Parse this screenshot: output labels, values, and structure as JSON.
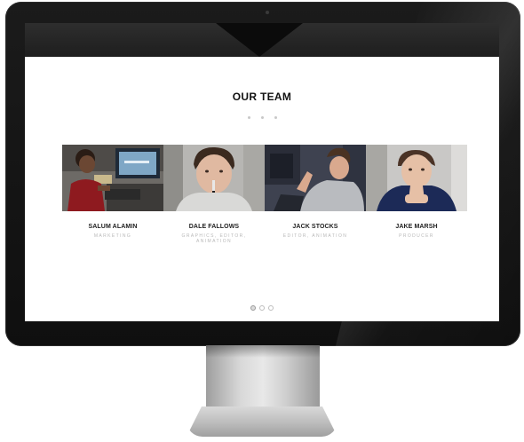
{
  "section": {
    "title": "OUR TEAM"
  },
  "team": [
    {
      "name": "SALUM ALAMIN",
      "role": "MARKETING"
    },
    {
      "name": "DALE FALLOWS",
      "role": "GRAPHICS, EDITOR, ANIMATION"
    },
    {
      "name": "JACK STOCKS",
      "role": "EDITOR, ANIMATION"
    },
    {
      "name": "JAKE MARSH",
      "role": "PRODUCER"
    }
  ],
  "pager": {
    "count": 3,
    "active": 1
  },
  "colors": {
    "bezel": "#111111",
    "topbar": "#262626",
    "title": "#111111",
    "role_text": "#b8b8b8"
  }
}
